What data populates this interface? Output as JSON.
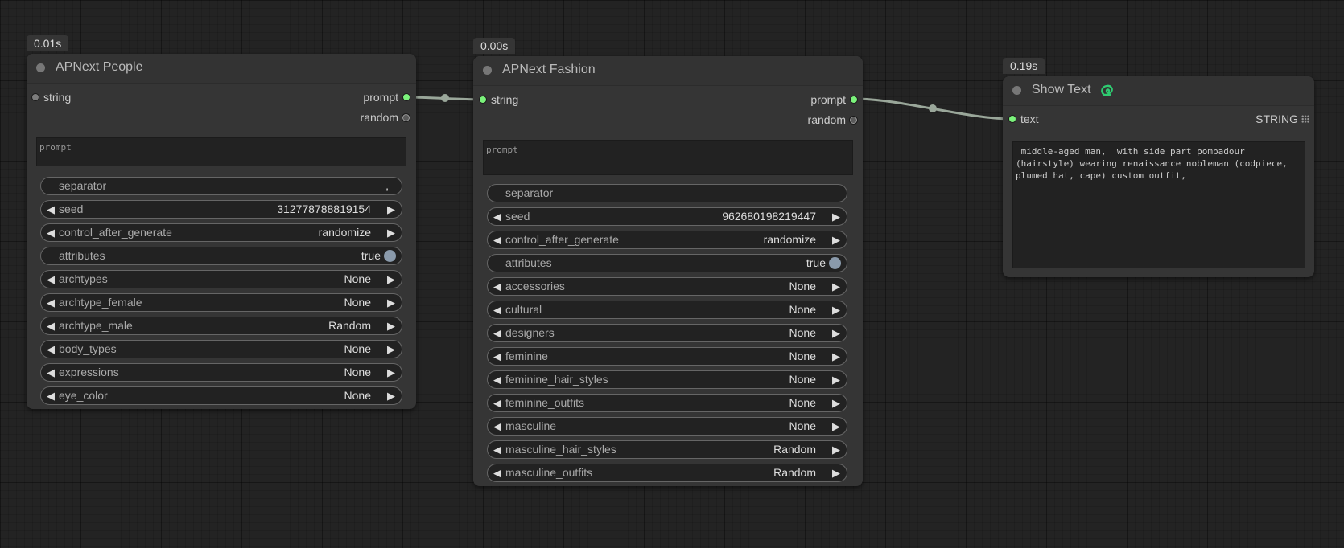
{
  "nodes": {
    "people": {
      "time": "0.01s",
      "title": "APNext People",
      "input_label": "string",
      "outputs": [
        "prompt",
        "random"
      ],
      "prompt_placeholder": "prompt",
      "separator": {
        "name": "separator",
        "value": ","
      },
      "seed": {
        "name": "seed",
        "value": "312778788819154"
      },
      "control_after_generate": {
        "name": "control_after_generate",
        "value": "randomize"
      },
      "attributes": {
        "name": "attributes",
        "value": "true"
      },
      "combos": [
        {
          "name": "archtypes",
          "value": "None"
        },
        {
          "name": "archtype_female",
          "value": "None"
        },
        {
          "name": "archtype_male",
          "value": "Random"
        },
        {
          "name": "body_types",
          "value": "None"
        },
        {
          "name": "expressions",
          "value": "None"
        },
        {
          "name": "eye_color",
          "value": "None"
        }
      ]
    },
    "fashion": {
      "time": "0.00s",
      "title": "APNext Fashion",
      "input_label": "string",
      "outputs": [
        "prompt",
        "random"
      ],
      "prompt_placeholder": "prompt",
      "separator": {
        "name": "separator",
        "value": ""
      },
      "seed": {
        "name": "seed",
        "value": "962680198219447"
      },
      "control_after_generate": {
        "name": "control_after_generate",
        "value": "randomize"
      },
      "attributes": {
        "name": "attributes",
        "value": "true"
      },
      "combos": [
        {
          "name": "accessories",
          "value": "None"
        },
        {
          "name": "cultural",
          "value": "None"
        },
        {
          "name": "designers",
          "value": "None"
        },
        {
          "name": "feminine",
          "value": "None"
        },
        {
          "name": "feminine_hair_styles",
          "value": "None"
        },
        {
          "name": "feminine_outfits",
          "value": "None"
        },
        {
          "name": "masculine",
          "value": "None"
        },
        {
          "name": "masculine_hair_styles",
          "value": "Random"
        },
        {
          "name": "masculine_outfits",
          "value": "Random"
        }
      ]
    },
    "showtext": {
      "time": "0.19s",
      "title": "Show Text",
      "title_icon": "link-snake-icon",
      "input_label": "text",
      "output_type": "STRING",
      "output_icon": "grid-dots-icon",
      "text": " middle-aged man,  with side part pompadour\n(hairstyle) wearing renaissance nobleman (codpiece,\nplumed hat, cape) custom outfit,"
    }
  },
  "colors": {
    "background": "#232323",
    "node": "#353535",
    "link": "#9aa79a",
    "pin_active": "#7bf27b",
    "toggle_knob": "#8a9aab",
    "title_icon": "#2ecc71"
  },
  "arrow_left": "◀",
  "arrow_right": "▶"
}
